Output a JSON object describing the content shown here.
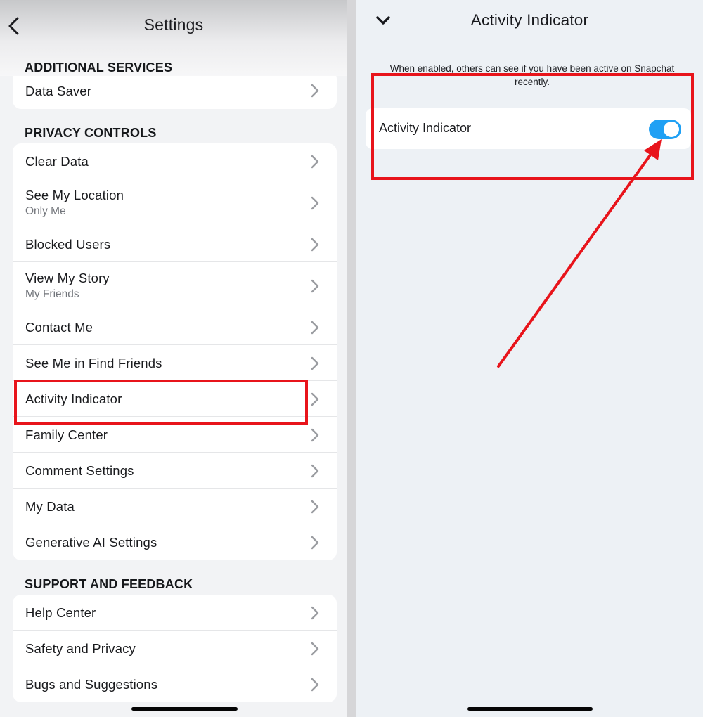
{
  "left": {
    "title": "Settings",
    "additional_services": {
      "header": "ADDITIONAL SERVICES",
      "items": [
        {
          "label": "Data Saver"
        }
      ]
    },
    "privacy_controls": {
      "header": "PRIVACY CONTROLS",
      "items": [
        {
          "label": "Clear Data",
          "sub": ""
        },
        {
          "label": "See My Location",
          "sub": "Only Me"
        },
        {
          "label": "Blocked Users",
          "sub": ""
        },
        {
          "label": "View My Story",
          "sub": "My Friends"
        },
        {
          "label": "Contact Me",
          "sub": ""
        },
        {
          "label": "See Me in Find Friends",
          "sub": ""
        },
        {
          "label": "Activity Indicator",
          "sub": ""
        },
        {
          "label": "Family Center",
          "sub": ""
        },
        {
          "label": "Comment Settings",
          "sub": ""
        },
        {
          "label": "My Data",
          "sub": ""
        },
        {
          "label": "Generative AI Settings",
          "sub": ""
        }
      ]
    },
    "support_feedback": {
      "header": "SUPPORT AND FEEDBACK",
      "items": [
        {
          "label": "Help Center"
        },
        {
          "label": "Safety and Privacy"
        },
        {
          "label": "Bugs and Suggestions"
        }
      ]
    }
  },
  "right": {
    "title": "Activity Indicator",
    "description": "When enabled, others can see if you have been active on Snapchat recently.",
    "toggle_label": "Activity Indicator",
    "toggle_on": true
  },
  "colors": {
    "annotation_red": "#e8141b",
    "toggle_blue": "#1fa0f4",
    "background": "#f2f3f5"
  },
  "icons": [
    "back-chevron-icon",
    "chevron-right-icon",
    "chevron-down-icon"
  ]
}
